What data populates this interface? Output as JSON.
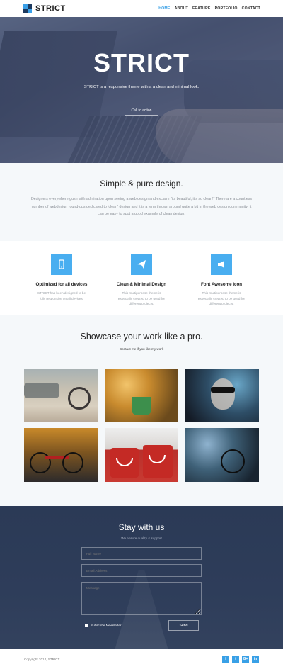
{
  "nav": {
    "brand": "STRICT",
    "items": [
      {
        "label": "HOME",
        "active": true
      },
      {
        "label": "ABOUT",
        "active": false
      },
      {
        "label": "FEATURE",
        "active": false
      },
      {
        "label": "PORTFOLIO",
        "active": false
      },
      {
        "label": "CONTACT",
        "active": false
      }
    ]
  },
  "hero": {
    "title": "STRICT",
    "subtitle": "STRICT is a responsive theme with a a clean and minimal look.",
    "cta": "Call to action"
  },
  "simple": {
    "title": "Simple & pure design.",
    "body": "Designers everywhere gush with admiration upon seeing a web design and exclaim \"its beautiful, it's so clean!\" There are a countless number of webdesign round-ups dedicated to 'clean' design and it is a term thrown around quite a bit in the web design community. It can be easy to spot a good example of clean design."
  },
  "features": [
    {
      "icon": "mobile-icon",
      "title": "Optimized for all devices",
      "text": "STRICT has been designed to be fully responsive on all devices."
    },
    {
      "icon": "paper-plane-icon",
      "title": "Clean & Minimal Design",
      "text": "This multipurpose theme is especially created to be used for different projects."
    },
    {
      "icon": "megaphone-icon",
      "title": "Font Awesome Icon",
      "text": "This multipurpose theme is especially created to be used for different projects."
    }
  ],
  "showcase": {
    "title": "Showcase your work like a pro.",
    "subtitle": "Contact me if you like my work"
  },
  "contact": {
    "title": "Stay with us",
    "subtitle": "We ensure quality & support",
    "fullname_placeholder": "Full Name",
    "email_placeholder": "Email Address",
    "message_placeholder": "Message",
    "newsletter": "Subscribe Newsletter",
    "send": "Send"
  },
  "footer": {
    "copyright": "Copyright 2014, STRICT",
    "socials": [
      "f",
      "t",
      "G+",
      "in"
    ]
  },
  "colors": {
    "accent": "#39a0e6",
    "contact_bg": "#2e3d5a",
    "light_bg": "#f5f8fa"
  }
}
